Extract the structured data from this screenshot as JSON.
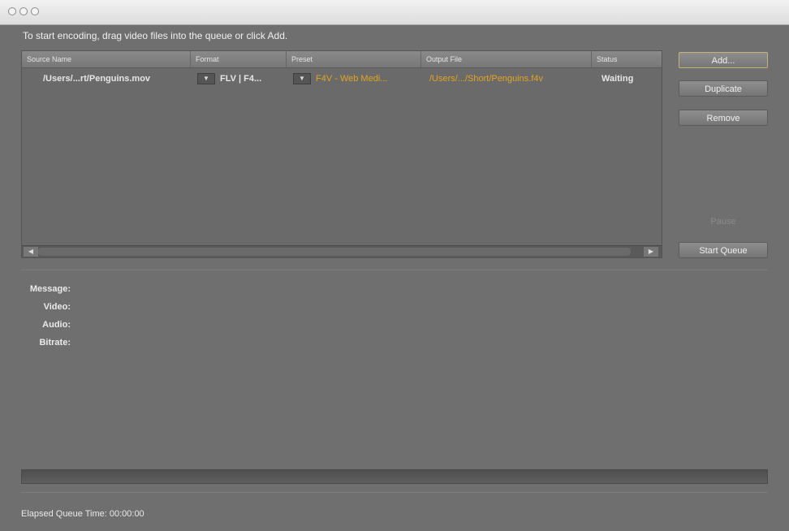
{
  "instruction": "To start encoding, drag video files into the queue or click Add.",
  "queue": {
    "columns": [
      "Source Name",
      "Format",
      "Preset",
      "Output File",
      "Status"
    ],
    "rows": [
      {
        "source": "/Users/...rt/Penguins.mov",
        "format": "FLV | F4...",
        "preset": "F4V - Web Medi...",
        "output": "/Users/.../Short/Penguins.f4v",
        "status": "Waiting"
      }
    ]
  },
  "buttons": {
    "add": "Add...",
    "duplicate": "Duplicate",
    "remove": "Remove",
    "pause": "Pause",
    "start": "Start Queue"
  },
  "info": {
    "message": "Message:",
    "video": "Video:",
    "audio": "Audio:",
    "bitrate": "Bitrate:"
  },
  "elapsed_label": "Elapsed Queue Time:",
  "elapsed_value": "00:00:00",
  "progress": 0,
  "icons": {
    "dropdown": "dropdown-arrow-icon",
    "scroll_left": "scroll-left-icon",
    "scroll_right": "scroll-right-icon"
  },
  "colors": {
    "accent_orange": "#e3a422",
    "background": "#6f6f6f"
  }
}
